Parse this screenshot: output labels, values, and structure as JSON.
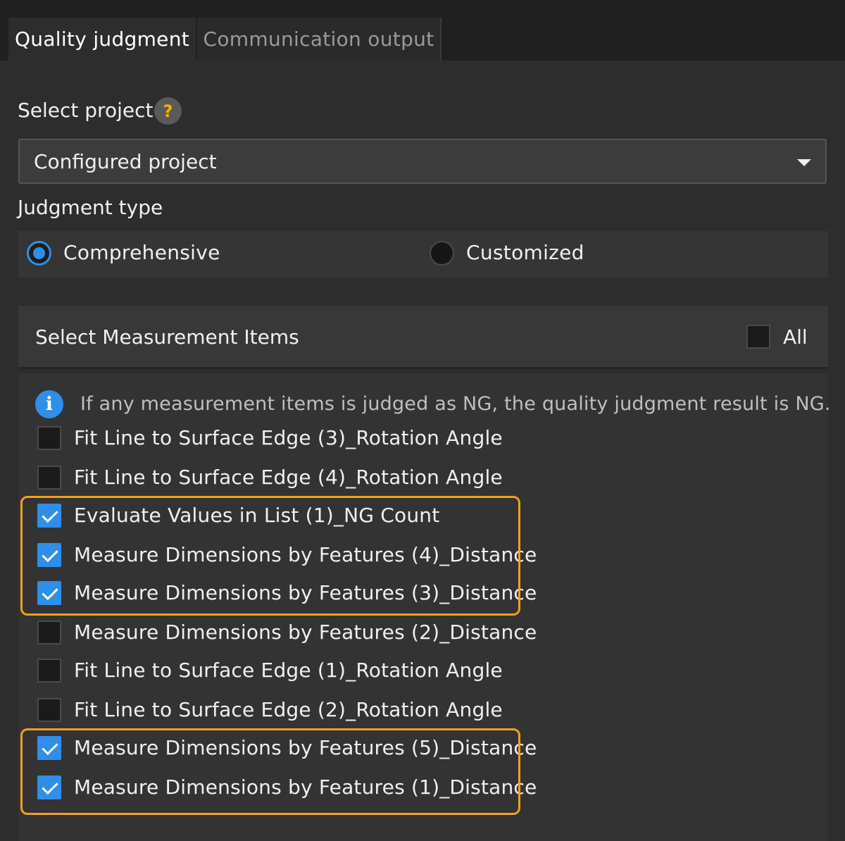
{
  "tabs": [
    {
      "label": "Quality judgment",
      "active": true
    },
    {
      "label": "Communication output",
      "active": false
    }
  ],
  "select_project": {
    "label": "Select project",
    "help_icon": "?",
    "value": "Configured project"
  },
  "judgment_type": {
    "label": "Judgment type",
    "options": [
      {
        "label": "Comprehensive",
        "selected": true
      },
      {
        "label": "Customized",
        "selected": false
      }
    ]
  },
  "measurement": {
    "title": "Select Measurement Items",
    "all_label": "All",
    "all_checked": false,
    "info_icon": "i",
    "info_text": "If any measurement items is judged as NG, the quality judgment result is NG.",
    "items": [
      {
        "label": "Fit Line to Surface Edge (3)_Rotation Angle",
        "checked": false
      },
      {
        "label": "Fit Line to Surface Edge (4)_Rotation Angle",
        "checked": false
      },
      {
        "label": "Evaluate Values in List (1)_NG Count",
        "checked": true
      },
      {
        "label": "Measure Dimensions by Features (4)_Distance",
        "checked": true
      },
      {
        "label": "Measure Dimensions by Features (3)_Distance",
        "checked": true
      },
      {
        "label": "Measure Dimensions by Features (2)_Distance",
        "checked": false
      },
      {
        "label": "Fit Line to Surface Edge (1)_Rotation Angle",
        "checked": false
      },
      {
        "label": "Fit Line to Surface Edge (2)_Rotation Angle",
        "checked": false
      },
      {
        "label": "Measure Dimensions by Features (5)_Distance",
        "checked": true
      },
      {
        "label": "Measure Dimensions by Features (1)_Distance",
        "checked": true
      }
    ]
  },
  "colors": {
    "accent": "#2f8fe8",
    "highlight": "#f0a020",
    "help": "#f0b400"
  }
}
